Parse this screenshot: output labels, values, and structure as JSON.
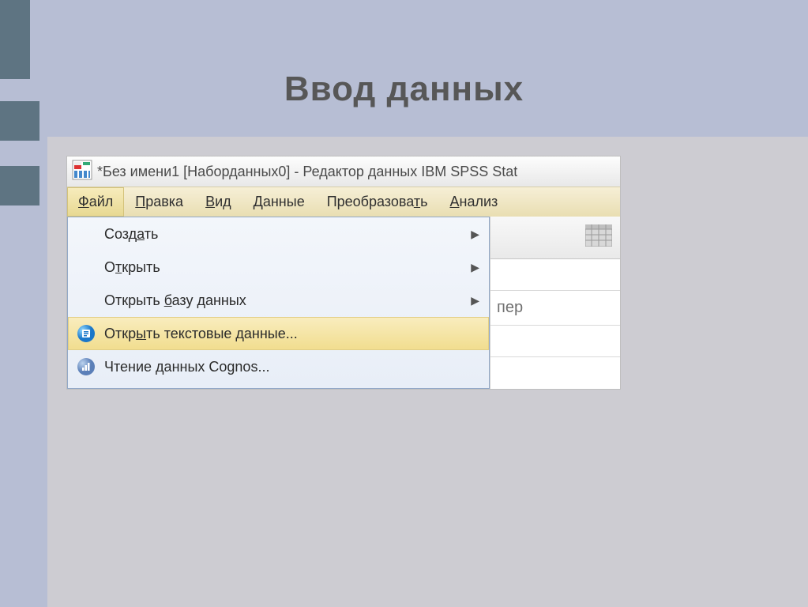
{
  "slide": {
    "title": "Ввод данных"
  },
  "window": {
    "title": "*Без имени1 [Наборданных0] - Редактор данных IBM SPSS Stat"
  },
  "menu": {
    "file": {
      "pre": "",
      "ul": "Ф",
      "post": "айл"
    },
    "edit": {
      "pre": "",
      "ul": "П",
      "post": "равка"
    },
    "view": {
      "pre": "",
      "ul": "В",
      "post": "ид"
    },
    "data": {
      "pre": "",
      "ul": "Д",
      "post": "анные"
    },
    "transform": {
      "pre": "Преобразова",
      "ul": "т",
      "post": "ь"
    },
    "analyze": {
      "pre": "",
      "ul": "А",
      "post": "нализ"
    }
  },
  "dropdown": {
    "create": {
      "pre": "Созд",
      "ul": "а",
      "post": "ть"
    },
    "open": {
      "pre": "О",
      "ul": "т",
      "post": "крыть"
    },
    "open_db": {
      "pre": "Открыть ",
      "ul": "б",
      "post": "азу данных"
    },
    "open_txt": {
      "pre": "Откр",
      "ul": "ы",
      "post": "ть текстовые данные..."
    },
    "cognos": {
      "pre": "Чтение данных Co",
      "ul": "g",
      "post": "nos..."
    }
  },
  "side": {
    "partial": "пер"
  }
}
